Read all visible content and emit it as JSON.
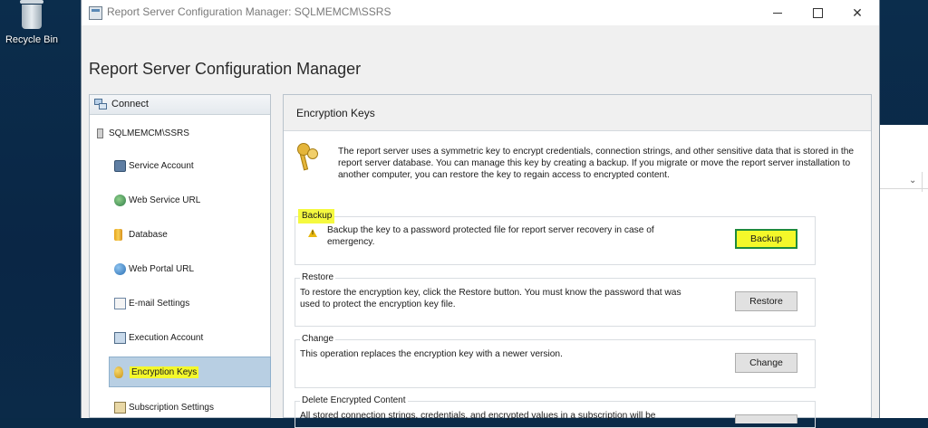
{
  "desktop": {
    "recycle_bin_label": "Recycle Bin"
  },
  "window": {
    "title": "Report Server Configuration Manager: SQLMEMCM\\SSRS",
    "app_header": "Report Server Configuration Manager"
  },
  "left_panel": {
    "connect_label": "Connect",
    "server_name": "SQLMEMCM\\SSRS",
    "nav_items": [
      {
        "label": "Service Account",
        "icon": "service-account-icon"
      },
      {
        "label": "Web Service URL",
        "icon": "web-service-icon"
      },
      {
        "label": "Database",
        "icon": "database-icon"
      },
      {
        "label": "Web Portal URL",
        "icon": "globe-icon"
      },
      {
        "label": "E-mail Settings",
        "icon": "email-icon"
      },
      {
        "label": "Execution Account",
        "icon": "execution-account-icon"
      },
      {
        "label": "Encryption Keys",
        "icon": "key-icon",
        "selected": true
      },
      {
        "label": "Subscription Settings",
        "icon": "subscription-icon"
      }
    ]
  },
  "right_panel": {
    "title": "Encryption Keys",
    "intro": "The report server uses a symmetric key to encrypt credentials, connection strings, and other sensitive data that is stored in the report server database.  You can manage this key by creating a backup.  If you migrate or move the report server installation to another computer, you can restore the key to regain access to encrypted content.",
    "sections": {
      "backup": {
        "label": "Backup",
        "description": "Backup the key to a password protected file for report server recovery in case of emergency.",
        "button": "Backup"
      },
      "restore": {
        "label": "Restore",
        "description": "To restore the encryption key, click the Restore button.  You must know the password that was used to protect the encryption key file.",
        "button": "Restore"
      },
      "change": {
        "label": "Change",
        "description": "This operation replaces the encryption key with a newer version.",
        "button": "Change"
      },
      "delete": {
        "label": "Delete Encrypted Content",
        "description": "All stored connection strings, credentials, and encrypted values in a subscription will be"
      }
    }
  },
  "colors": {
    "highlight": "#f4f82a",
    "selection": "#b8cfe3",
    "highlight_border": "#1f8a3c"
  }
}
